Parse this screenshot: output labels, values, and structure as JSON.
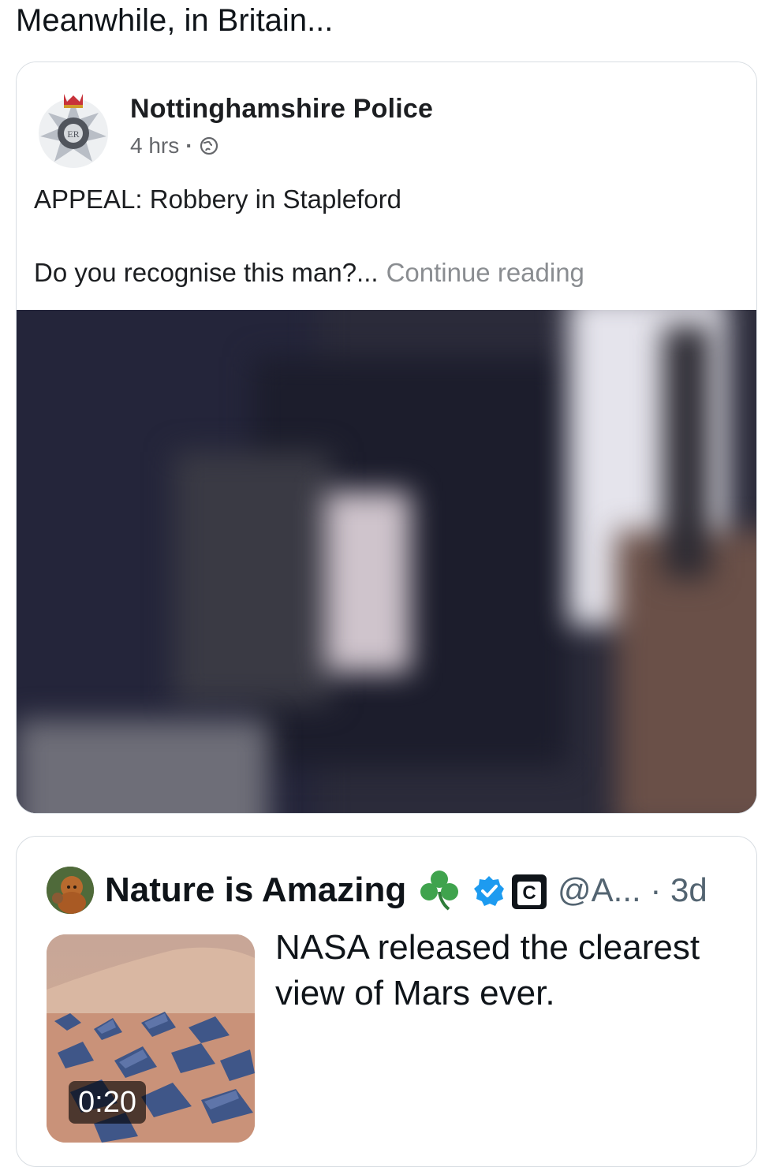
{
  "caption": "Meanwhile, in Britain...",
  "facebook_post": {
    "page_name": "Nottinghamshire Police",
    "time": "4 hrs",
    "separator": "·",
    "badge_icon": "police-crest-icon",
    "audience_icon": "globe-icon",
    "headline": "APPEAL: Robbery in Stapleford",
    "body": "Do you recognise this man?...",
    "continue_label": "Continue reading"
  },
  "quoted_tweet": {
    "display_name": "Nature is Amazing",
    "emoji": "shamrock",
    "verified": true,
    "badge_letter": "C",
    "handle_and_time": "@A... · 3d",
    "text": "NASA released the clearest view of Mars ever.",
    "video_duration": "0:20"
  },
  "colors": {
    "text_primary": "#0f1419",
    "text_secondary": "#536471",
    "fb_secondary": "#65676b",
    "verified_blue": "#1d9bf0",
    "card_border": "#d8dde2"
  }
}
